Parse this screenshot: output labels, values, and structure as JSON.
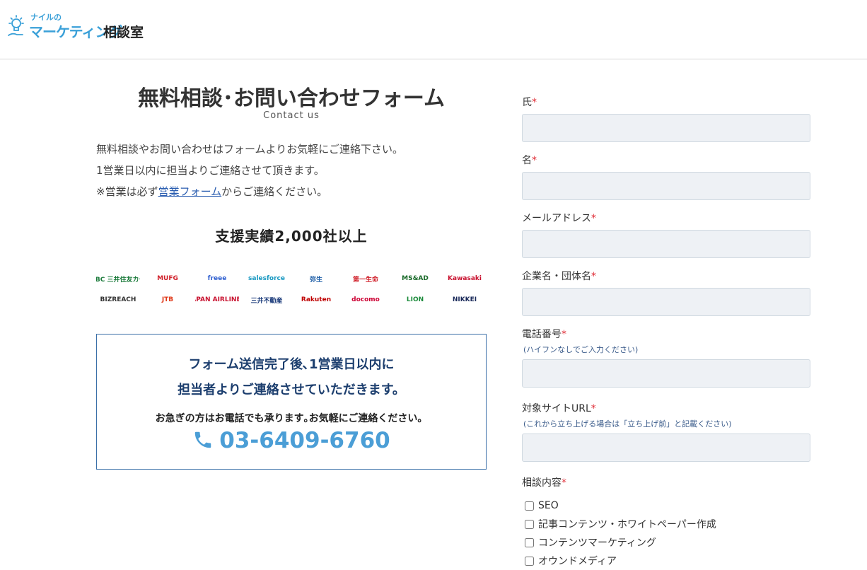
{
  "header": {
    "logo_small": "ナイルの",
    "logo_main": "マーケティング",
    "logo_sub": "相談室"
  },
  "page": {
    "title": "無料相談･お問い合わせフォーム",
    "subtitle": "Contact us",
    "intro_line1": "無料相談やお問い合わせはフォームよりお気軽にご連絡下さい。",
    "intro_line2": "1営業日以内に担当よりご連絡させて頂きます。",
    "intro_line3_pre": "※営業は必ず",
    "intro_line3_link": "営業フォーム",
    "intro_line3_post": "からご連絡ください。",
    "achievement": "支援実績2,000社以上"
  },
  "clients": {
    "row1": [
      {
        "name": "SMBC 三井住友カード",
        "color": "#1a7a3a"
      },
      {
        "name": "MUFG",
        "color": "#d0202a"
      },
      {
        "name": "freee",
        "color": "#2f5fd0"
      },
      {
        "name": "salesforce",
        "color": "#1798c1"
      },
      {
        "name": "弥生",
        "color": "#1f5fa8"
      },
      {
        "name": "第一生命",
        "color": "#d0202a"
      },
      {
        "name": "MS&AD",
        "color": "#1a6a2a"
      },
      {
        "name": "Kawasaki",
        "color": "#c8102e"
      }
    ],
    "row2": [
      {
        "name": "BIZREACH",
        "color": "#333333"
      },
      {
        "name": "JTB",
        "color": "#e03a1a"
      },
      {
        "name": "JAPAN AIRLINES",
        "color": "#c8102e"
      },
      {
        "name": "三井不動産",
        "color": "#1a3a7a"
      },
      {
        "name": "Rakuten",
        "color": "#bf0000"
      },
      {
        "name": "docomo",
        "color": "#cc0033"
      },
      {
        "name": "LION",
        "color": "#1a8a3a"
      },
      {
        "name": "NIKKEI",
        "color": "#1a2a5a"
      }
    ]
  },
  "contact_box": {
    "line1": "フォーム送信完了後､1営業日以内に",
    "line2": "担当者よりご連絡させていただきます。",
    "note": "お急ぎの方はお電話でも承ります｡お気軽にご連絡ください。",
    "phone": "03-6409-6760",
    "phone_icon": "phone-icon",
    "accent_color": "#4b9ed6"
  },
  "form": {
    "last_name": {
      "label": "氏",
      "required": "*",
      "value": ""
    },
    "first_name": {
      "label": "名",
      "required": "*",
      "value": ""
    },
    "email": {
      "label": "メールアドレス",
      "required": "*",
      "value": ""
    },
    "company": {
      "label": "企業名・団体名",
      "required": "*",
      "value": ""
    },
    "phone": {
      "label": "電話番号",
      "required": "*",
      "hint": "(ハイフンなしでご入力ください)",
      "value": ""
    },
    "site_url": {
      "label": "対象サイトURL",
      "required": "*",
      "hint": "(これから立ち上げる場合は「立ち上げ前」と記載ください)",
      "value": ""
    },
    "consult": {
      "label": "相談内容",
      "required": "*",
      "options": [
        "SEO",
        "記事コンテンツ・ホワイトペーパー作成",
        "コンテンツマーケティング",
        "オウンドメディア"
      ]
    }
  }
}
